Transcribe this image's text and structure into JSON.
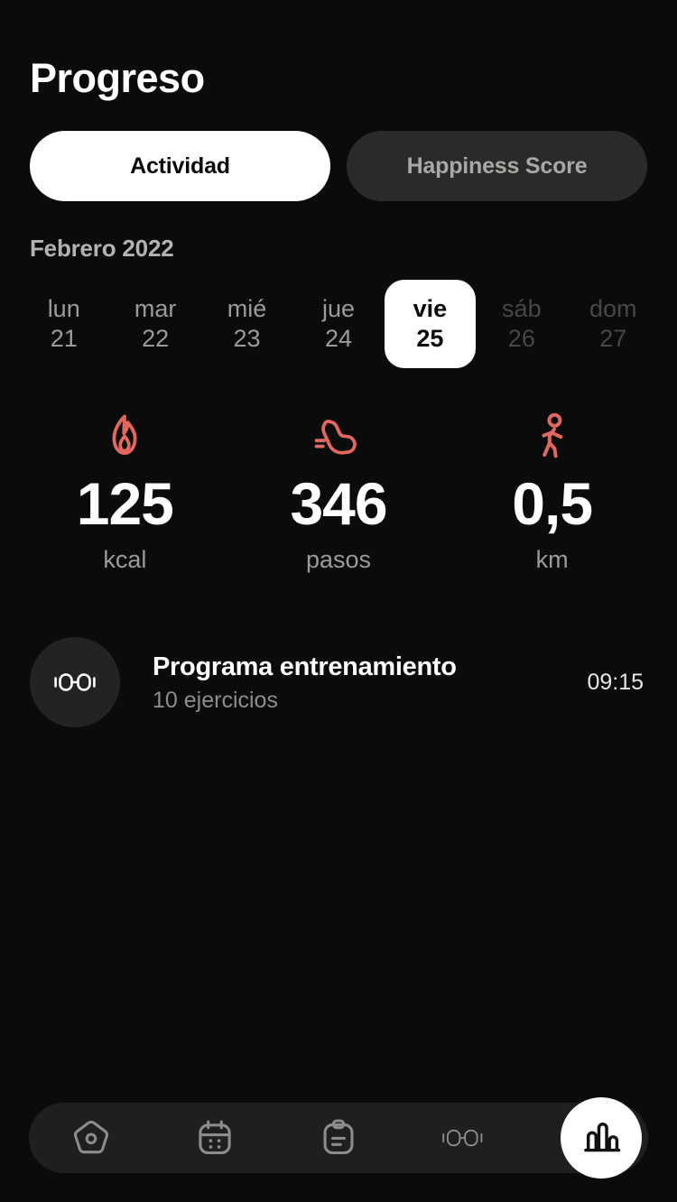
{
  "header": {
    "title": "Progreso"
  },
  "tabs": [
    {
      "label": "Actividad",
      "active": true
    },
    {
      "label": "Happiness Score",
      "active": false
    }
  ],
  "calendar": {
    "month_label": "Febrero 2022",
    "days": [
      {
        "name": "lun",
        "num": "21",
        "selected": false,
        "weekend": false
      },
      {
        "name": "mar",
        "num": "22",
        "selected": false,
        "weekend": false
      },
      {
        "name": "mié",
        "num": "23",
        "selected": false,
        "weekend": false
      },
      {
        "name": "jue",
        "num": "24",
        "selected": false,
        "weekend": false
      },
      {
        "name": "vie",
        "num": "25",
        "selected": true,
        "weekend": false
      },
      {
        "name": "sáb",
        "num": "26",
        "selected": false,
        "weekend": true
      },
      {
        "name": "dom",
        "num": "27",
        "selected": false,
        "weekend": true
      }
    ]
  },
  "stats": [
    {
      "icon": "flame-icon",
      "value": "125",
      "unit": "kcal"
    },
    {
      "icon": "shoe-icon",
      "value": "346",
      "unit": "pasos"
    },
    {
      "icon": "walking-icon",
      "value": "0,5",
      "unit": "km"
    }
  ],
  "workouts": [
    {
      "icon": "dumbbell-icon",
      "title": "Programa entrenamiento",
      "subtitle": "10 ejercicios",
      "time": "09:15"
    }
  ],
  "bottom_nav": [
    {
      "icon": "home-icon",
      "active": false
    },
    {
      "icon": "calendar-icon",
      "active": false
    },
    {
      "icon": "clipboard-icon",
      "active": false
    },
    {
      "icon": "dumbbell-icon",
      "active": false
    },
    {
      "icon": "bar-chart-icon",
      "active": true
    }
  ],
  "colors": {
    "background": "#0b0b0b",
    "accent": "#e0685f",
    "surface": "#2a2a28",
    "nav_surface": "#1f1f1f",
    "text_primary": "#ffffff",
    "text_muted": "#9b9b9b",
    "text_dim": "#474747"
  }
}
